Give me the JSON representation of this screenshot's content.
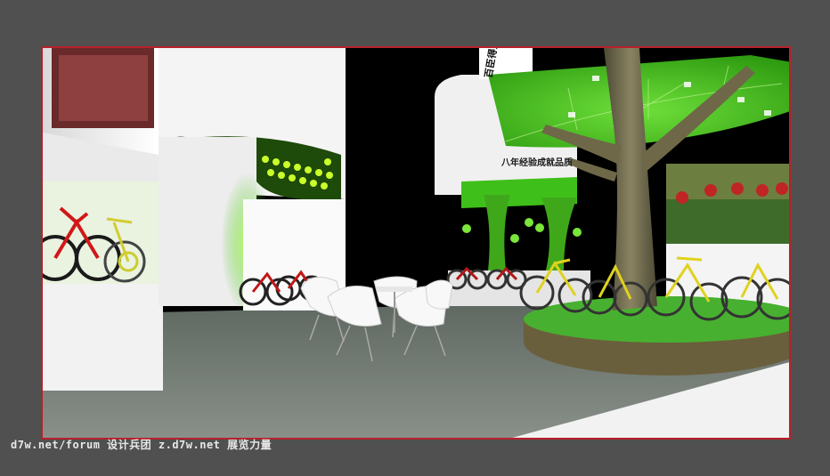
{
  "watermark": {
    "text": "d7w.net/forum 设计兵团 z.d7w.net 展览力量"
  },
  "scene": {
    "subject": "3D rendering of a bicycle exhibition booth with a central tree, green leaf canopy, white lounge chairs and displayed bicycles",
    "sign_upper": "百臣得意",
    "sign_lower": "八年经验成就品质"
  },
  "colors": {
    "frame_border": "#b8202a",
    "accent_green": "#3fbf1a",
    "floor": "#6f7770",
    "background": "#505050"
  }
}
